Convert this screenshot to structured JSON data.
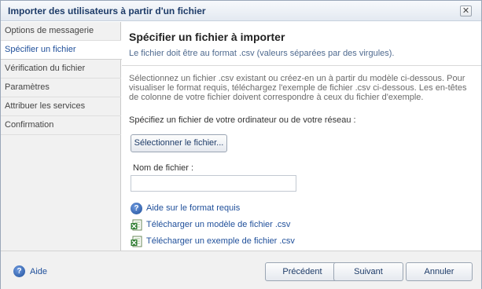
{
  "window": {
    "title": "Importer des utilisateurs à partir d'un fichier",
    "close_glyph": "✕"
  },
  "sidebar": {
    "items": [
      {
        "label": "Options de messagerie",
        "active": false
      },
      {
        "label": "Spécifier un fichier",
        "active": true
      },
      {
        "label": "Vérification du fichier",
        "active": false
      },
      {
        "label": "Paramètres",
        "active": false
      },
      {
        "label": "Attribuer les services",
        "active": false
      },
      {
        "label": "Confirmation",
        "active": false
      }
    ]
  },
  "main": {
    "heading": "Spécifier un fichier à importer",
    "subheading": "Le fichier doit être au format .csv (valeurs séparées par des virgules).",
    "description": "Sélectionnez un fichier .csv existant ou créez-en un à partir du modèle ci-dessous. Pour visualiser le format requis, téléchargez l'exemple de fichier .csv ci-dessous. Les en-têtes de colonne de votre fichier doivent correspondre à ceux du fichier d'exemple.",
    "prompt": "Spécifiez un fichier de votre ordinateur ou de votre réseau :",
    "select_button": "Sélectionner le fichier...",
    "filename_label": "Nom de fichier :",
    "filename_value": "",
    "links": {
      "help": "Aide sur le format requis",
      "template": "Télécharger un modèle de fichier .csv",
      "example": "Télécharger un exemple de fichier .csv"
    },
    "icons": {
      "help": "help-icon",
      "excel": "excel-file-icon"
    }
  },
  "footer": {
    "help_label": "Aide",
    "prev_label": "Précédent",
    "next_label": "Suivant",
    "cancel_label": "Annuler"
  },
  "colors": {
    "accent": "#1f4f9a",
    "title": "#1d3b68"
  }
}
